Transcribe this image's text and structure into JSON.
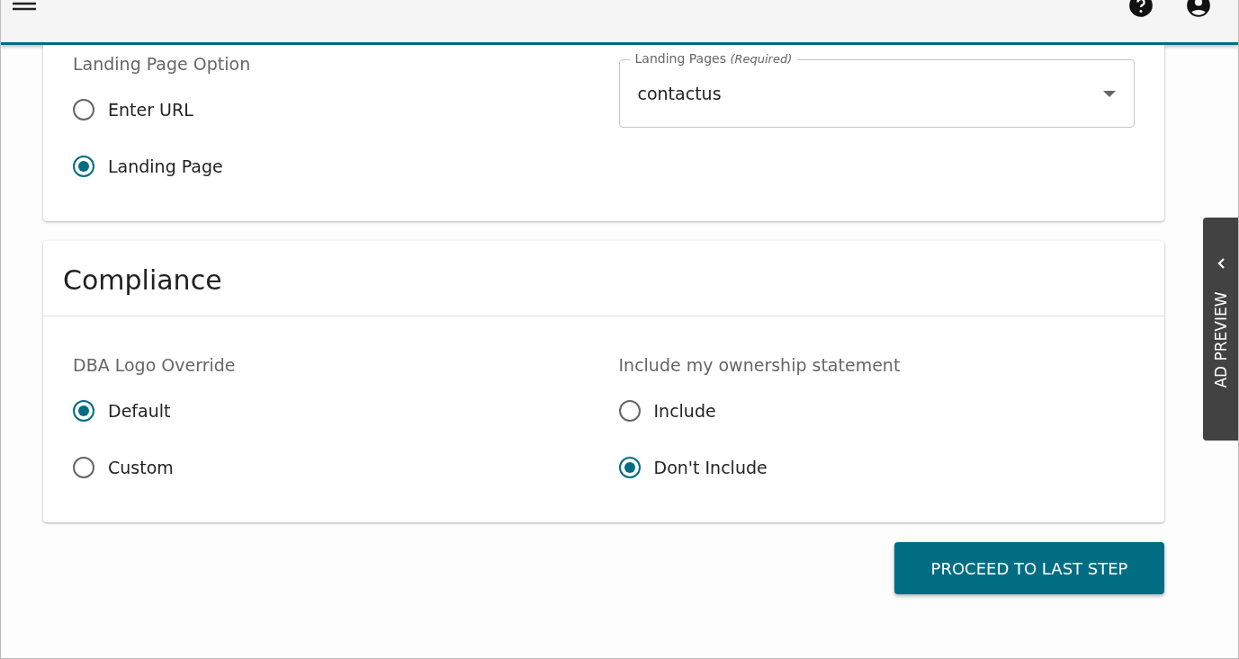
{
  "landing": {
    "option_group": {
      "label": "Landing Page Option",
      "options": [
        {
          "label": "Enter URL",
          "selected": false
        },
        {
          "label": "Landing Page",
          "selected": true
        }
      ]
    },
    "select": {
      "label": "Landing Pages",
      "hint": "(Required)",
      "value": "contactus"
    }
  },
  "compliance": {
    "title": "Compliance",
    "groups": [
      {
        "label": "DBA Logo Override",
        "options": [
          {
            "label": "Default",
            "selected": true
          },
          {
            "label": "Custom",
            "selected": false
          }
        ]
      },
      {
        "label": "Include my ownership statement",
        "options": [
          {
            "label": "Include",
            "selected": false
          },
          {
            "label": "Don't Include",
            "selected": true
          }
        ]
      }
    ]
  },
  "proceed_button": "PROCEED TO LAST STEP",
  "side_tab": "AD PREVIEW"
}
